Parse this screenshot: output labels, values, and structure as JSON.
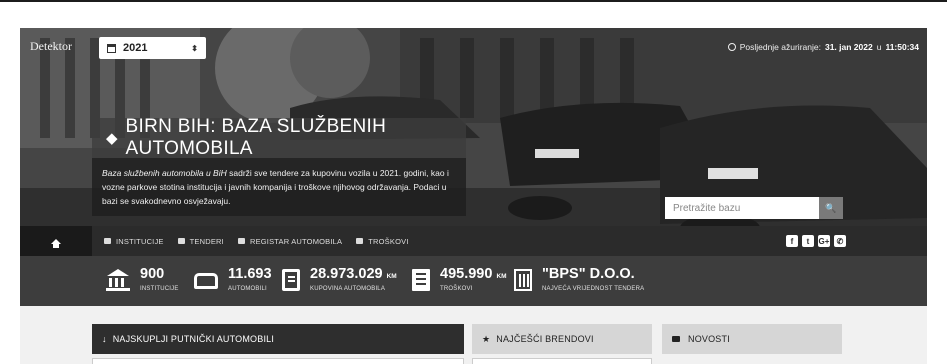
{
  "header": {
    "brand": "Detektor",
    "year": "2021",
    "updated_prefix": "Posljednje ažuriranje:",
    "updated_date": "31. jan 2022",
    "updated_sep": "u",
    "updated_time": "11:50:34"
  },
  "hero": {
    "title": "BIRN BIH: BAZA SLUŽBENIH AUTOMOBILA",
    "desc_italic": "Baza službenih automobila u BiH",
    "desc_rest": " sadrži sve tendere za kupovinu vozila u 2021. godini, kao i vozne parkove stotina institucija i javnih kompanija i troškove njihovog održavanja. Podaci u bazi se svakodnevno osvježavaju.",
    "search_placeholder": "Pretražite bazu",
    "search_button": "🔍"
  },
  "nav": {
    "items": [
      {
        "label": "INSTITUCIJE"
      },
      {
        "label": "TENDERI"
      },
      {
        "label": "REGISTAR AUTOMOBILA"
      },
      {
        "label": "TROŠKOVI"
      }
    ],
    "social": [
      "f",
      "t",
      "G+",
      "✆"
    ]
  },
  "stats": [
    {
      "value": "900",
      "unit": "",
      "label": "INSTITUCIJE",
      "icon": "bank-icon"
    },
    {
      "value": "11.693",
      "unit": "",
      "label": "AUTOMOBILI",
      "icon": "car-icon"
    },
    {
      "value": "28.973.029",
      "unit": "KM",
      "label": "KUPOVINA AUTOMOBILA",
      "icon": "document-icon"
    },
    {
      "value": "495.990",
      "unit": "KM",
      "label": "TROŠKOVI",
      "icon": "list-icon"
    },
    {
      "value": "\"BPS\" D.O.O.",
      "unit": "",
      "label": "NAJVEĆA VRIJEDNOST TENDERA",
      "icon": "building-icon"
    }
  ],
  "panels": {
    "expensive": "NAJSKUPLJI PUTNIČKI AUTOMOBILI",
    "brands": "NAJČEŠĆI BRENDOVI",
    "news": "NOVOSTI"
  }
}
